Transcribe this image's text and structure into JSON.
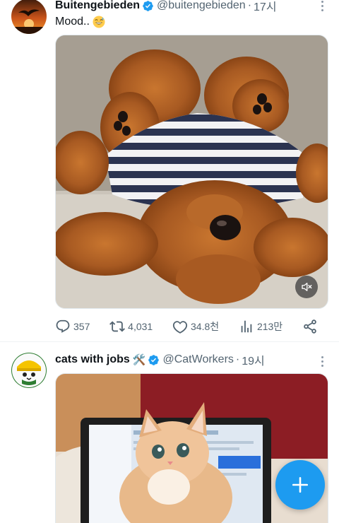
{
  "tweets": [
    {
      "display_name": "Buitengebieden",
      "handle": "@buitengebieden",
      "separator": "·",
      "time": "17시",
      "text": "Mood..",
      "emoji": "grinning-sweat-face",
      "media_kind": "video",
      "media_desc": "poodle-puppy-in-striped-shirt",
      "muted": true,
      "stats": {
        "replies": "357",
        "retweets": "4,031",
        "likes": "34.8천",
        "views": "213만"
      }
    },
    {
      "display_name": "cats with jobs",
      "name_emoji": "🛠️",
      "handle": "@CatWorkers",
      "separator": "·",
      "time": "19시",
      "media_kind": "image",
      "media_desc": "kitten-in-front-of-laptop"
    }
  ],
  "colors": {
    "accent": "#1d9bf0",
    "muted_text": "#536471",
    "verified": "#1d9bf0"
  },
  "fab": {
    "icon": "plus-icon"
  }
}
